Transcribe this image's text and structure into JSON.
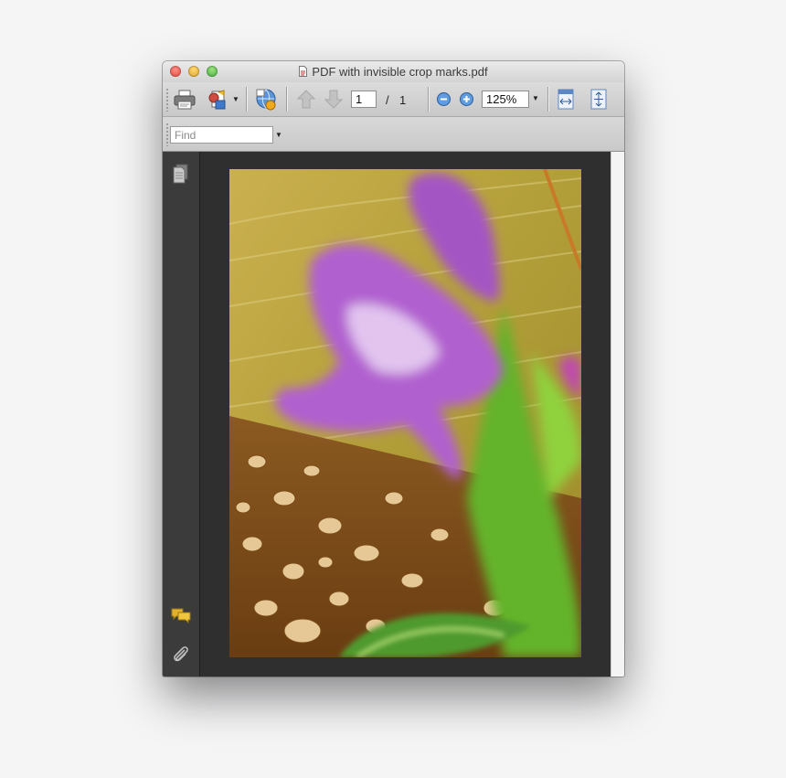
{
  "window": {
    "title": "PDF with invisible crop marks.pdf"
  },
  "toolbar": {
    "current_page": "1",
    "page_separator": "/",
    "total_pages": "1",
    "zoom_level": "125%"
  },
  "find": {
    "placeholder": "Find"
  },
  "sidebar": {
    "icons": [
      "pages-icon",
      "comments-icon",
      "attachments-icon"
    ]
  },
  "colors": {
    "sidebar_bg": "#3b3b3b",
    "viewer_bg": "#2f2f2f",
    "comment_icon": "#e0b12b"
  }
}
